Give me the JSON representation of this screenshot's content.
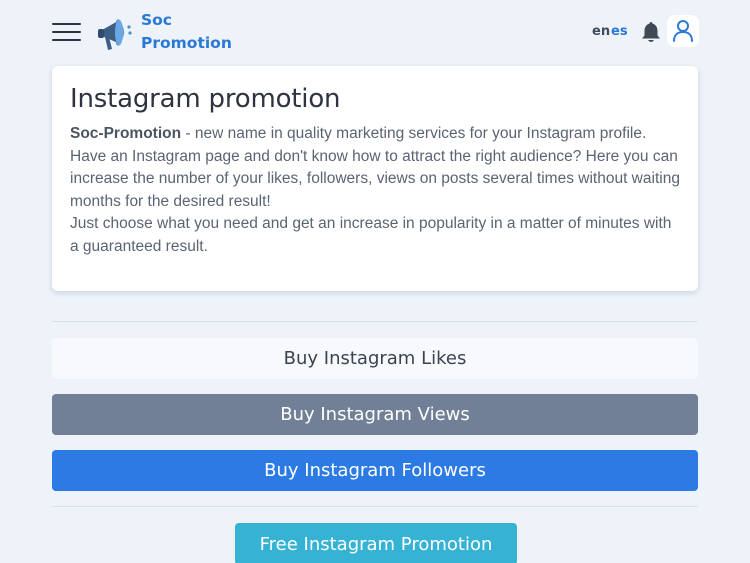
{
  "header": {
    "brand_line1": "Soc",
    "brand_line2": "Promotion",
    "lang_en": "en",
    "lang_es": "es",
    "brand_color": "#2b78d6"
  },
  "card": {
    "title": "Instagram promotion",
    "intro_bold": "Soc-Promotion",
    "intro_text": " - new name in quality marketing services for your Instagram profile. Have an Instagram page and don't know how to attract the right audience? Here you can increase the number of your likes, followers, views on posts several times without waiting months for the desired result!",
    "second_text": "Just choose what you need and get an increase in popularity in a matter of minutes with a guaranteed result."
  },
  "buttons": {
    "likes": "Buy Instagram Likes",
    "views": "Buy Instagram Views",
    "followers": "Buy Instagram Followers",
    "free": "Free Instagram Promotion"
  },
  "colors": {
    "views_bg": "#718096",
    "followers_bg": "#2c7be5",
    "free_bg": "#36b2d4"
  }
}
